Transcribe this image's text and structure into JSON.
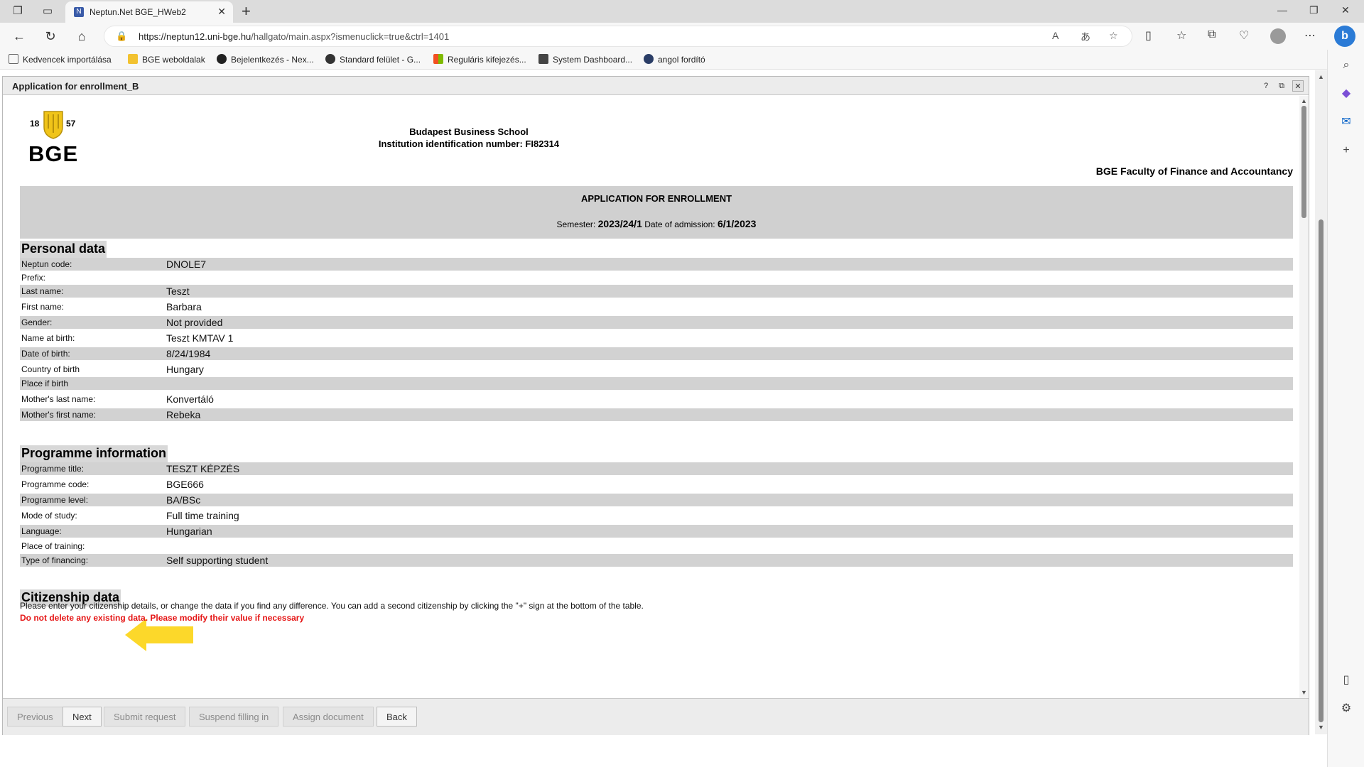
{
  "browser": {
    "tab_title": "Neptun.Net BGE_HWeb2",
    "url_host": "https://neptun12.uni-bge.hu",
    "url_path": "/hallgato/main.aspx?ismenuclick=true&ctrl=1401",
    "bookmarks": [
      {
        "label": "Kedvencek importálása",
        "color": "#666666"
      },
      {
        "label": "BGE weboldalak",
        "color": "#f2c230"
      },
      {
        "label": "Bejelentkezés - Nex...",
        "color": "#222222"
      },
      {
        "label": "Standard felület - G...",
        "color": "#333333"
      },
      {
        "label": "Reguláris kifejezés...",
        "color": "#e44d26"
      },
      {
        "label": "System Dashboard...",
        "color": "#444444"
      },
      {
        "label": "angol fordító",
        "color": "#2a3d66"
      }
    ],
    "bing_label": "b"
  },
  "modal": {
    "title": "Application for enrollment_B",
    "help": "?",
    "restore": "⧉",
    "close": "✕"
  },
  "header": {
    "logo_year_left": "18",
    "logo_year_right": "57",
    "logo_name": "BGE",
    "school_name": "Budapest Business School",
    "institution_id": "Institution identification number: FI82314",
    "faculty": "BGE Faculty of Finance and Accountancy"
  },
  "banner": {
    "title": "APPLICATION FOR ENROLLMENT",
    "semester_label": "Semester:",
    "semester_value": "2023/24/1",
    "admission_label": "Date of admission:",
    "admission_value": "6/1/2023"
  },
  "personal": {
    "title": "Personal data",
    "rows": [
      {
        "label": "Neptun code:",
        "value": "DNOLE7"
      },
      {
        "label": "Prefix:",
        "value": ""
      },
      {
        "label": "Last name:",
        "value": "Teszt"
      },
      {
        "label": "First name:",
        "value": "Barbara"
      },
      {
        "label": "Gender:",
        "value": "Not provided"
      },
      {
        "label": "Name at birth:",
        "value": "Teszt KMTAV 1"
      },
      {
        "label": "Date of birth:",
        "value": "8/24/1984"
      },
      {
        "label": "Country of birth",
        "value": " Hungary"
      },
      {
        "label": "Place if birth",
        "value": ""
      },
      {
        "label": "Mother's last name:",
        "value": "Konvertáló"
      },
      {
        "label": "Mother's first name:",
        "value": "Rebeka"
      }
    ]
  },
  "programme": {
    "title": "Programme information",
    "rows": [
      {
        "label": "Programme title:",
        "value": "TESZT KÉPZÉS"
      },
      {
        "label": "Programme code:",
        "value": "BGE666"
      },
      {
        "label": "Programme level:",
        "value": "BA/BSc"
      },
      {
        "label": "Mode of study:",
        "value": "Full time training"
      },
      {
        "label": "Language:",
        "value": "Hungarian"
      },
      {
        "label": "Place of training:",
        "value": ""
      },
      {
        "label": "Type of financing:",
        "value": "Self supporting student"
      }
    ]
  },
  "citizenship": {
    "title": "Citizenship data",
    "info": "Please enter your citizenship details, or change the data if you find any difference. You can add a second citizenship by clicking the \"+\" sign at the bottom of the table.",
    "warning": "Do not delete any existing data. Please modify their value if necessary"
  },
  "footer": {
    "previous": "Previous",
    "next": "Next",
    "submit": "Submit request",
    "suspend": "Suspend filling in",
    "assign": "Assign document",
    "back": "Back"
  },
  "colors": {
    "arrow": "#fcd82a",
    "warning": "#e51515",
    "shade": "#d2d2d2"
  }
}
